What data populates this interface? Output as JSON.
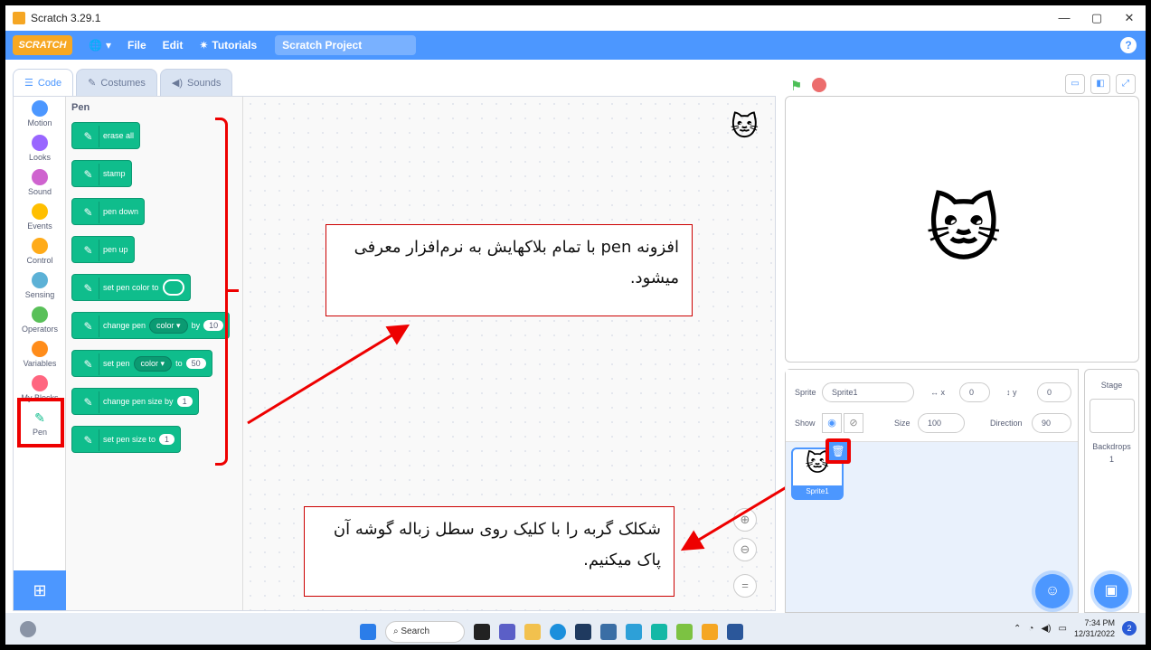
{
  "window": {
    "title": "Scratch 3.29.1",
    "controls": [
      "—",
      "▢",
      "✕"
    ]
  },
  "menubar": {
    "logo": "SCRATCH",
    "file": "File",
    "edit": "Edit",
    "tutorials": "Tutorials",
    "project_title": "Scratch Project"
  },
  "tabs": [
    {
      "label": "Code",
      "icon": "code-icon"
    },
    {
      "label": "Costumes",
      "icon": "brush-icon"
    },
    {
      "label": "Sounds",
      "icon": "speaker-icon"
    }
  ],
  "categories": [
    {
      "label": "Motion",
      "color": "#4c97ff"
    },
    {
      "label": "Looks",
      "color": "#9966ff"
    },
    {
      "label": "Sound",
      "color": "#cf63cf"
    },
    {
      "label": "Events",
      "color": "#ffbf00"
    },
    {
      "label": "Control",
      "color": "#ffab19"
    },
    {
      "label": "Sensing",
      "color": "#5cb1d6"
    },
    {
      "label": "Operators",
      "color": "#59c059"
    },
    {
      "label": "Variables",
      "color": "#ff8c1a"
    },
    {
      "label": "My Blocks",
      "color": "#ff6680"
    },
    {
      "label": "Pen",
      "color": "#0fbd8c"
    }
  ],
  "palette": {
    "title": "Pen",
    "blocks": {
      "erase_all": "erase all",
      "stamp": "stamp",
      "pen_down": "pen down",
      "pen_up": "pen up",
      "set_color": "set pen color to",
      "change_pen": "change pen",
      "color_drop": "color ▾",
      "by": "by",
      "change_val": "10",
      "set_pen": "set pen",
      "to": "to",
      "set_val": "50",
      "change_size": "change pen size by",
      "change_size_val": "1",
      "set_size": "set pen size to",
      "set_size_val": "1"
    }
  },
  "notes": {
    "top": "افزونه pen با تمام بلاکهایش به نرم‌افزار معرفی میشود.",
    "bottom": "شکلک گربه را با کلیک روی سطل زباله گوشه آن پاک میکنیم."
  },
  "sprite_info": {
    "sprite_label": "Sprite",
    "sprite_name": "Sprite1",
    "x_label": "x",
    "x": "0",
    "y_label": "y",
    "y": "0",
    "show_label": "Show",
    "size_label": "Size",
    "size": "100",
    "direction_label": "Direction",
    "direction": "90"
  },
  "sprite_thumb": {
    "label": "Sprite1"
  },
  "stage_pane": {
    "title": "Stage",
    "backdrops_label": "Backdrops",
    "backdrops_count": "1"
  },
  "taskbar": {
    "search": "Search",
    "time": "7:34 PM",
    "date": "12/31/2022",
    "notifications": "2"
  }
}
